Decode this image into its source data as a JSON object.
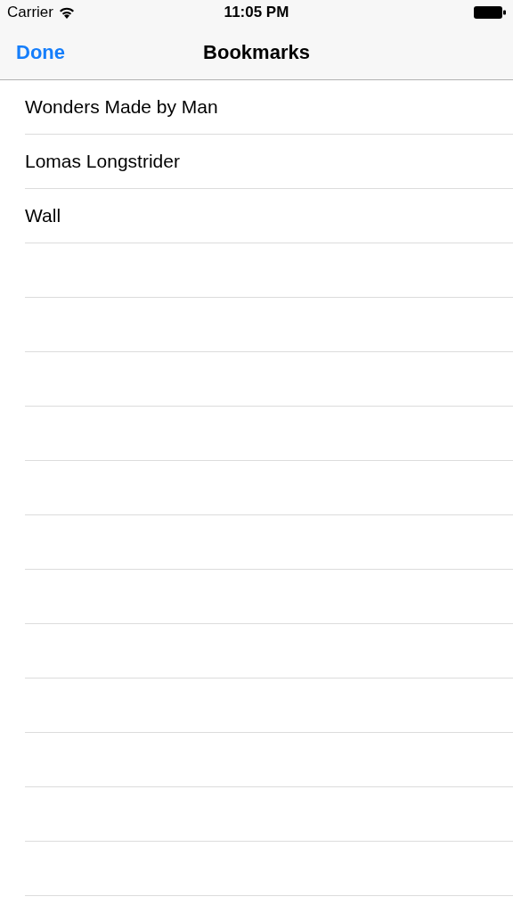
{
  "status_bar": {
    "carrier": "Carrier",
    "time": "11:05 PM"
  },
  "nav_bar": {
    "left_button": "Done",
    "title": "Bookmarks"
  },
  "bookmarks": [
    {
      "title": "Wonders Made by Man"
    },
    {
      "title": "Lomas Longstrider"
    },
    {
      "title": "Wall"
    }
  ]
}
